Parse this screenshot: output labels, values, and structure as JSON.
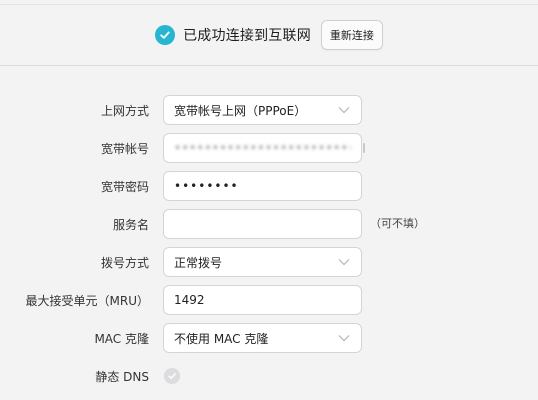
{
  "status": {
    "message": "已成功连接到互联网",
    "reconnect_label": "重新连接",
    "accent_color": "#27b6cf"
  },
  "form": {
    "connection_mode": {
      "label": "上网方式",
      "value": "宽带帐号上网（PPPoE）"
    },
    "account": {
      "label": "宽带帐号",
      "value": "••••••••••••••••••••••••••"
    },
    "password": {
      "label": "宽带密码",
      "value": "••••••••"
    },
    "service_name": {
      "label": "服务名",
      "value": "",
      "hint": "（可不填）"
    },
    "dial_mode": {
      "label": "拨号方式",
      "value": "正常拨号"
    },
    "mru": {
      "label": "最大接受单元（MRU）",
      "value": "1492"
    },
    "mac_clone": {
      "label": "MAC 克隆",
      "value": "不使用 MAC 克隆"
    },
    "static_dns": {
      "label": "静态 DNS",
      "checked": false
    }
  },
  "icons": {
    "status": "check-circle-icon",
    "dropdown": "chevron-down-icon",
    "dns": "check-circle-icon"
  }
}
